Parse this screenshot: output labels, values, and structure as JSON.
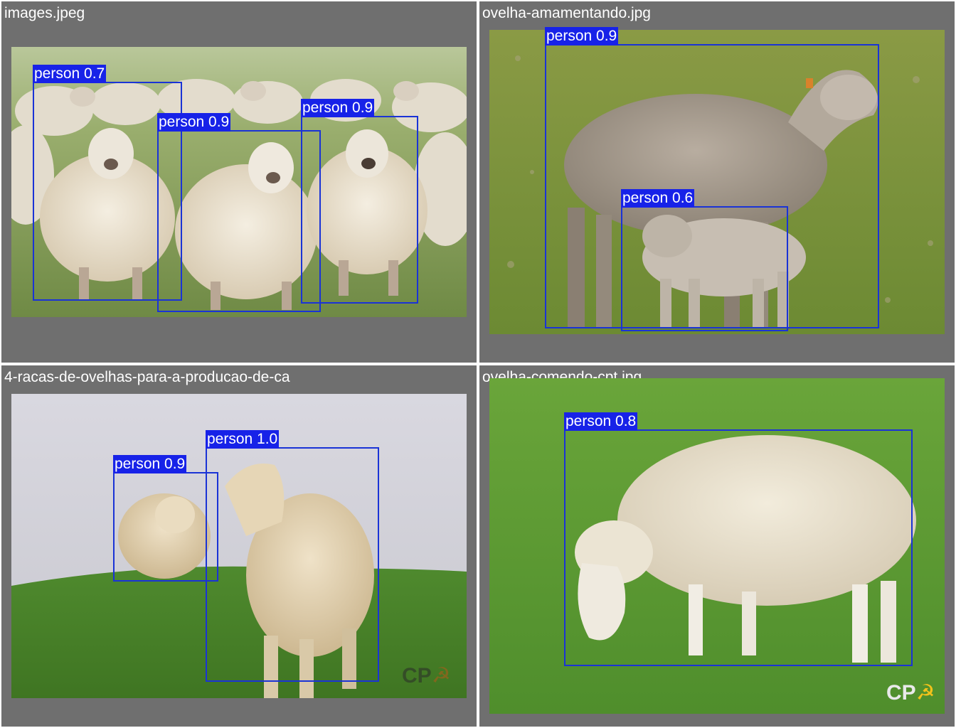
{
  "panels": [
    {
      "title": "images.jpeg",
      "detections": [
        {
          "label": "person 0.7"
        },
        {
          "label": "person 0.9"
        },
        {
          "label": "person 0.9"
        }
      ]
    },
    {
      "title": "ovelha-amamentando.jpg",
      "detections": [
        {
          "label": "person 0.9"
        },
        {
          "label": "person 0.6"
        }
      ]
    },
    {
      "title": "4-racas-de-ovelhas-para-a-producao-de-ca",
      "detections": [
        {
          "label": "person 0.9"
        },
        {
          "label": "person 1.0"
        }
      ],
      "watermark": "CP"
    },
    {
      "title": "ovelha-comendo-cpt.jpg",
      "detections": [
        {
          "label": "person 0.8"
        }
      ],
      "watermark": "CP"
    }
  ],
  "colors": {
    "panel_background": "#6f6f6f",
    "box_stroke": "#1a33d6",
    "label_background": "#1722e8",
    "label_text": "#ffffff"
  }
}
